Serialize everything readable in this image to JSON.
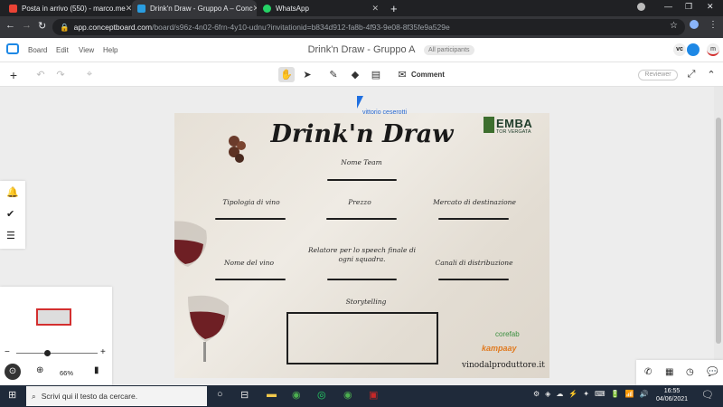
{
  "browser": {
    "tabs": [
      {
        "title": "Posta in arrivo (550) - marco.me",
        "favicon_color": "#ea4335",
        "active": false
      },
      {
        "title": "Drink'n Draw - Gruppo A – Conc",
        "favicon_color": "#2a9de0",
        "active": true
      },
      {
        "title": "WhatsApp",
        "favicon_color": "#25d366",
        "active": false
      }
    ],
    "new_tab_label": "+",
    "url_host": "app.conceptboard.com",
    "url_path": "/board/s96z-4n02-6frn-4y10-udnu?invitationid=b834d912-fa8b-4f93-9e08-8f35fe9a529e"
  },
  "app": {
    "menu": [
      "Board",
      "Edit",
      "View",
      "Help"
    ],
    "board_title": "Drink'n Draw - Gruppo A",
    "participants_label": "All participants",
    "avatar_initials": "vc",
    "user_initial": "m",
    "comment_label": "Comment",
    "reviewer_label": "Reviewer",
    "collaborator_name": "vittorio ceserotti"
  },
  "board": {
    "heading": "Drink'n Draw",
    "nome_team": "Nome Team",
    "tipologia": "Tipologia di vino",
    "prezzo": "Prezzo",
    "mercato": "Mercato di destinazione",
    "nome_vino": "Nome del vino",
    "relatore": "Relatore per lo speech finale di ogni squadra.",
    "canali": "Canali di distribuzione",
    "storytelling": "Storytelling",
    "emba": "EMBA",
    "emba_sub": "TOR VERGATA",
    "corefab": "corefab",
    "kampaay": "kampaay",
    "vinodal": "vinodalproduttore.it"
  },
  "minimap": {
    "zoom_level": "66%",
    "zoom_minus": "−",
    "zoom_plus": "+"
  },
  "taskbar": {
    "search_placeholder": "Scrivi qui il testo da cercare.",
    "time": "16:55",
    "date": "04/06/2021"
  }
}
